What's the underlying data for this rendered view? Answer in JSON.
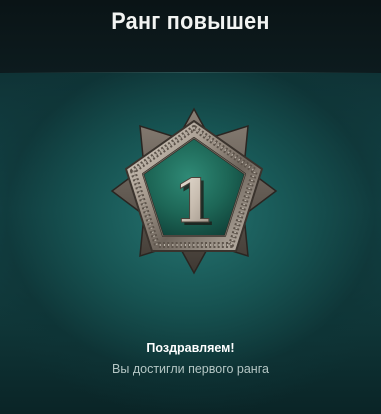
{
  "dialog": {
    "title": "Ранг повышен",
    "rank_number": "1",
    "congrats": "Поздравляем!",
    "subtitle": "Вы достигли первого ранга"
  },
  "colors": {
    "panel_teal": "#14474a",
    "badge_face": "#1f6a5c",
    "badge_metal": "#b3aa9f",
    "numeral": "#d8cfc3"
  },
  "icons": {
    "badge": "rank-pentagon-badge"
  }
}
